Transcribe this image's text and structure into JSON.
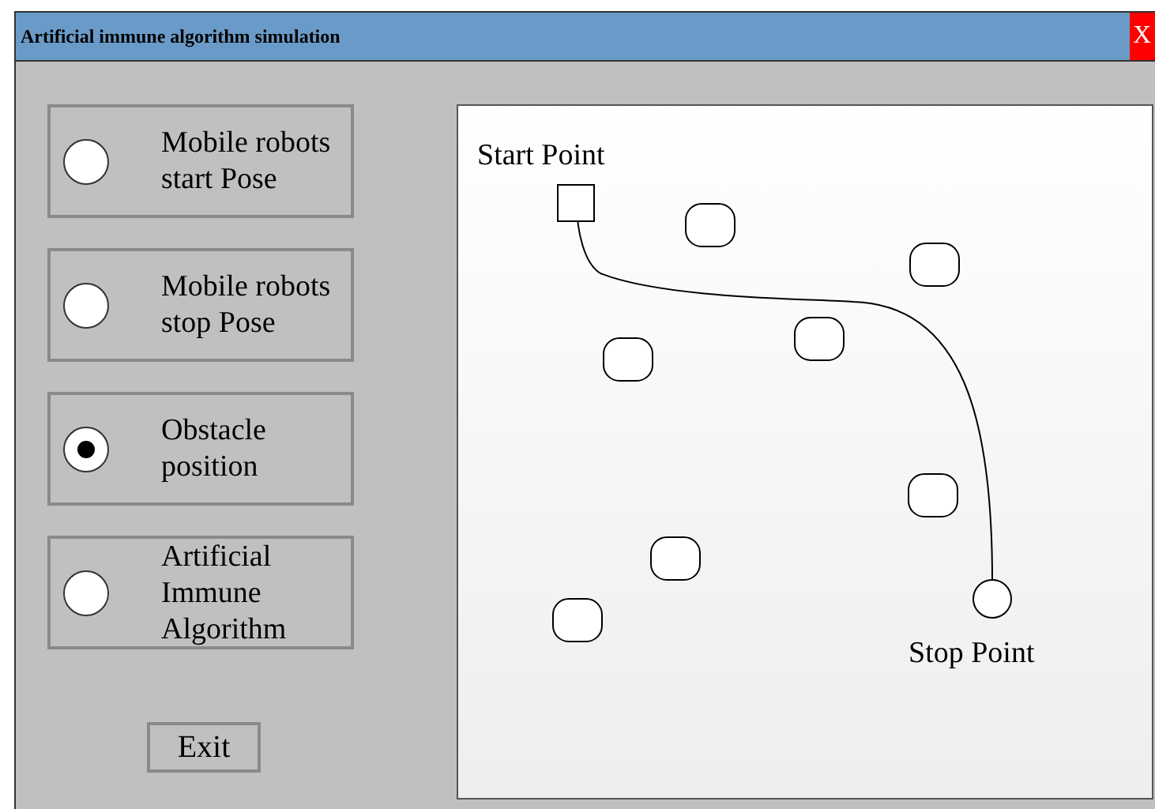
{
  "window": {
    "title": "Artificial immune algorithm simulation",
    "close": "X"
  },
  "options": [
    {
      "label": "Mobile robots start Pose",
      "selected": false
    },
    {
      "label": "Mobile robots stop Pose",
      "selected": false
    },
    {
      "label": "Obstacle position",
      "selected": true
    },
    {
      "label": "Artificial Immune Algorithm",
      "selected": false
    }
  ],
  "exit_button": "Exit",
  "canvas": {
    "start_label": "Start Point",
    "stop_label": "Stop Point"
  }
}
